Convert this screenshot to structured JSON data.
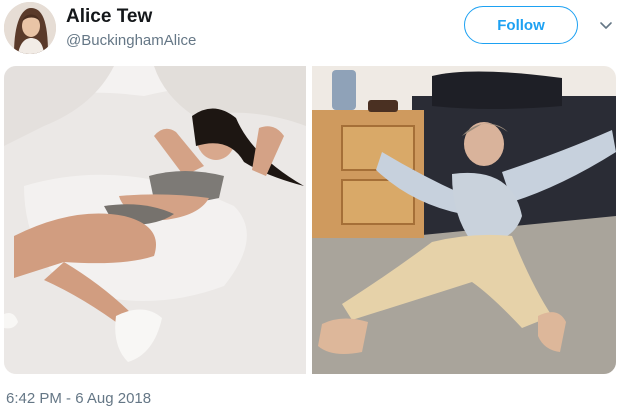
{
  "tweet": {
    "display_name": "Alice Tew",
    "handle": "@BuckinghamAlice",
    "follow_label": "Follow",
    "timestamp": "6:42 PM - 6 Aug 2018"
  },
  "icons": {
    "more": "chevron-down-icon"
  },
  "colors": {
    "accent": "#1da1f2",
    "secondary_text": "#657786"
  }
}
